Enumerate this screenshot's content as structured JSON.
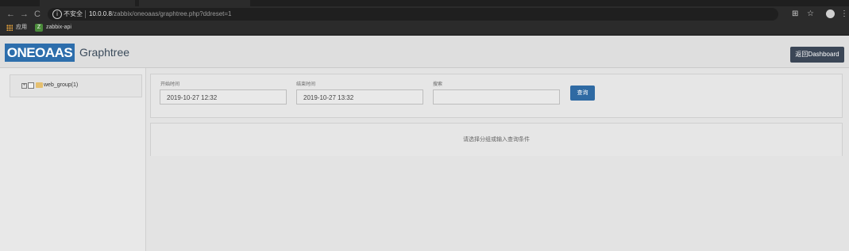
{
  "browser": {
    "address": {
      "insecure_label": "不安全",
      "host": "10.0.0.8",
      "path": "/zabbix/oneoaas/graphtree.php?ddreset=1"
    },
    "bookmarks": [
      {
        "label": "应用",
        "icon": "apps-grid-icon"
      },
      {
        "label": "zabbix-api",
        "icon": "zabbix-favicon"
      }
    ]
  },
  "app": {
    "logo_text": "ONEOAAS",
    "title": "Graphtree",
    "dashboard_button": "返回Dashboard"
  },
  "tree": {
    "root_label": "web_group(1)"
  },
  "filters": {
    "start_label": "开始时间",
    "start_value": "2019-10-27 12:32",
    "end_label": "结束时间",
    "end_value": "2019-10-27 13:32",
    "search_label": "搜索",
    "search_value": "",
    "query_button": "查询"
  },
  "results": {
    "hint": "请选择分组或输入查询条件"
  },
  "colors": {
    "brand": "#2d6eac",
    "dashboard_button": "#3b4656",
    "query_button": "#2f6aa3"
  }
}
